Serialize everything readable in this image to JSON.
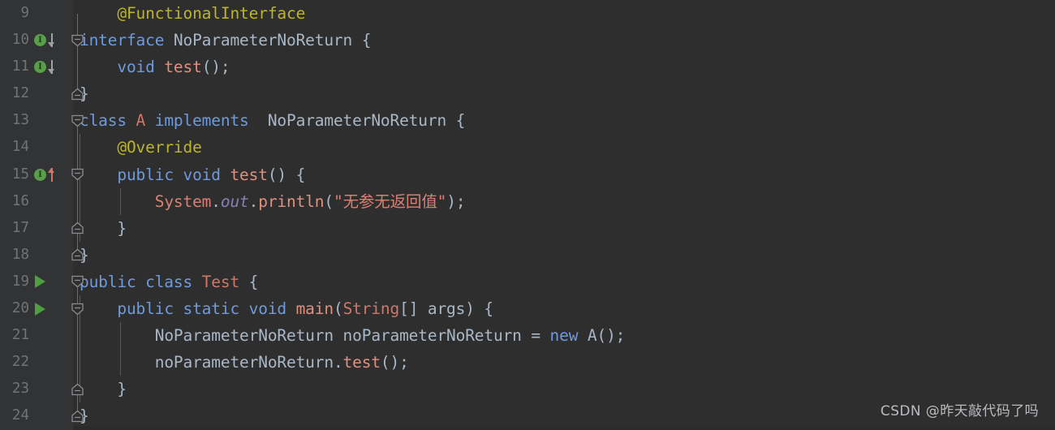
{
  "editor": {
    "theme": "darcula",
    "background_color": "#2e2e2e",
    "gutter_color": "#313335",
    "first_line": 9,
    "last_line": 24
  },
  "colors": {
    "keyword": "#6f9adb",
    "annotation": "#bbb529",
    "string": "#d98073",
    "class_ref": "#d0766a",
    "method": "#e0907f",
    "static_field": "#8a7fb5",
    "default_text": "#a9b7c6",
    "line_number": "#717375",
    "implemented_marker": "#5a9e4b",
    "run_marker": "#4f9e3f",
    "override_arrow": "#d0766a"
  },
  "lines": [
    {
      "number": "9",
      "marker": "none",
      "fold": "none",
      "fold_line": "half-bot",
      "indent_guides": 0,
      "tokens": [
        {
          "text": "    ",
          "class": "punct"
        },
        {
          "text": "@FunctionalInterface",
          "class": "anno"
        }
      ]
    },
    {
      "number": "10",
      "marker": "implemented-down",
      "fold": "start",
      "fold_line": "full",
      "indent_guides": 0,
      "tokens": [
        {
          "text": "interface ",
          "class": "kw"
        },
        {
          "text": "NoParameterNoReturn",
          "class": "cls"
        },
        {
          "text": " {",
          "class": "punct"
        }
      ]
    },
    {
      "number": "11",
      "marker": "implemented-down",
      "fold": "none",
      "fold_line": "full",
      "indent_guides": 0,
      "tokens": [
        {
          "text": "    ",
          "class": "punct"
        },
        {
          "text": "void ",
          "class": "kw"
        },
        {
          "text": "test",
          "class": "mth"
        },
        {
          "text": "();",
          "class": "punct"
        }
      ]
    },
    {
      "number": "12",
      "marker": "none",
      "fold": "end",
      "fold_line": "half-top",
      "indent_guides": 0,
      "tokens": [
        {
          "text": "}",
          "class": "punct"
        }
      ]
    },
    {
      "number": "13",
      "marker": "none",
      "fold": "start",
      "fold_line": "half-bot",
      "indent_guides": 0,
      "tokens": [
        {
          "text": "class ",
          "class": "kw"
        },
        {
          "text": "A",
          "class": "type"
        },
        {
          "text": " implements",
          "class": "kw"
        },
        {
          "text": "  ",
          "class": "punct"
        },
        {
          "text": "NoParameterNoReturn",
          "class": "cls"
        },
        {
          "text": " {",
          "class": "punct"
        }
      ]
    },
    {
      "number": "14",
      "marker": "none",
      "fold": "none",
      "fold_line": "full",
      "indent_guides": 1,
      "tokens": [
        {
          "text": "    ",
          "class": "punct"
        },
        {
          "text": "@Override",
          "class": "anno"
        }
      ]
    },
    {
      "number": "15",
      "marker": "implemented-up",
      "fold": "start",
      "fold_line": "full",
      "indent_guides": 1,
      "tokens": [
        {
          "text": "    ",
          "class": "punct"
        },
        {
          "text": "public void ",
          "class": "kw"
        },
        {
          "text": "test",
          "class": "mth"
        },
        {
          "text": "() {",
          "class": "punct"
        }
      ]
    },
    {
      "number": "16",
      "marker": "none",
      "fold": "none",
      "fold_line": "full",
      "indent_guides": 2,
      "tokens": [
        {
          "text": "        ",
          "class": "punct"
        },
        {
          "text": "System",
          "class": "sysout"
        },
        {
          "text": ".",
          "class": "punct"
        },
        {
          "text": "out",
          "class": "fld"
        },
        {
          "text": ".",
          "class": "punct"
        },
        {
          "text": "println",
          "class": "mth"
        },
        {
          "text": "(",
          "class": "punct"
        },
        {
          "text": "\"无参无返回值\"",
          "class": "str"
        },
        {
          "text": ");",
          "class": "punct"
        }
      ]
    },
    {
      "number": "17",
      "marker": "none",
      "fold": "end",
      "fold_line": "full",
      "indent_guides": 1,
      "tokens": [
        {
          "text": "    }",
          "class": "punct"
        }
      ]
    },
    {
      "number": "18",
      "marker": "none",
      "fold": "end",
      "fold_line": "half-top",
      "indent_guides": 0,
      "tokens": [
        {
          "text": "}",
          "class": "punct"
        }
      ]
    },
    {
      "number": "19",
      "marker": "run",
      "fold": "start",
      "fold_line": "half-bot",
      "indent_guides": 0,
      "tokens": [
        {
          "text": "public class ",
          "class": "kw"
        },
        {
          "text": "Test",
          "class": "type"
        },
        {
          "text": " {",
          "class": "punct"
        }
      ]
    },
    {
      "number": "20",
      "marker": "run",
      "fold": "start",
      "fold_line": "full",
      "indent_guides": 1,
      "tokens": [
        {
          "text": "    ",
          "class": "punct"
        },
        {
          "text": "public static void ",
          "class": "kw"
        },
        {
          "text": "main",
          "class": "mth"
        },
        {
          "text": "(",
          "class": "punct"
        },
        {
          "text": "String",
          "class": "type"
        },
        {
          "text": "[] args) {",
          "class": "punct"
        }
      ]
    },
    {
      "number": "21",
      "marker": "none",
      "fold": "none",
      "fold_line": "full",
      "indent_guides": 2,
      "tokens": [
        {
          "text": "        ",
          "class": "punct"
        },
        {
          "text": "NoParameterNoReturn",
          "class": "cls"
        },
        {
          "text": " noParameterNoReturn = ",
          "class": "ident"
        },
        {
          "text": "new ",
          "class": "kw"
        },
        {
          "text": "A",
          "class": "cls"
        },
        {
          "text": "();",
          "class": "punct"
        }
      ]
    },
    {
      "number": "22",
      "marker": "none",
      "fold": "none",
      "fold_line": "full",
      "indent_guides": 2,
      "tokens": [
        {
          "text": "        ",
          "class": "punct"
        },
        {
          "text": "noParameterNoReturn",
          "class": "ident"
        },
        {
          "text": ".",
          "class": "punct"
        },
        {
          "text": "test",
          "class": "mth"
        },
        {
          "text": "();",
          "class": "punct"
        }
      ]
    },
    {
      "number": "23",
      "marker": "none",
      "fold": "end",
      "fold_line": "full",
      "indent_guides": 1,
      "tokens": [
        {
          "text": "    }",
          "class": "punct"
        }
      ]
    },
    {
      "number": "24",
      "marker": "none",
      "fold": "end",
      "fold_line": "half-top",
      "indent_guides": 0,
      "tokens": [
        {
          "text": "}",
          "class": "punct"
        }
      ]
    }
  ],
  "watermark": {
    "text": "CSDN @昨天敲代码了吗"
  }
}
